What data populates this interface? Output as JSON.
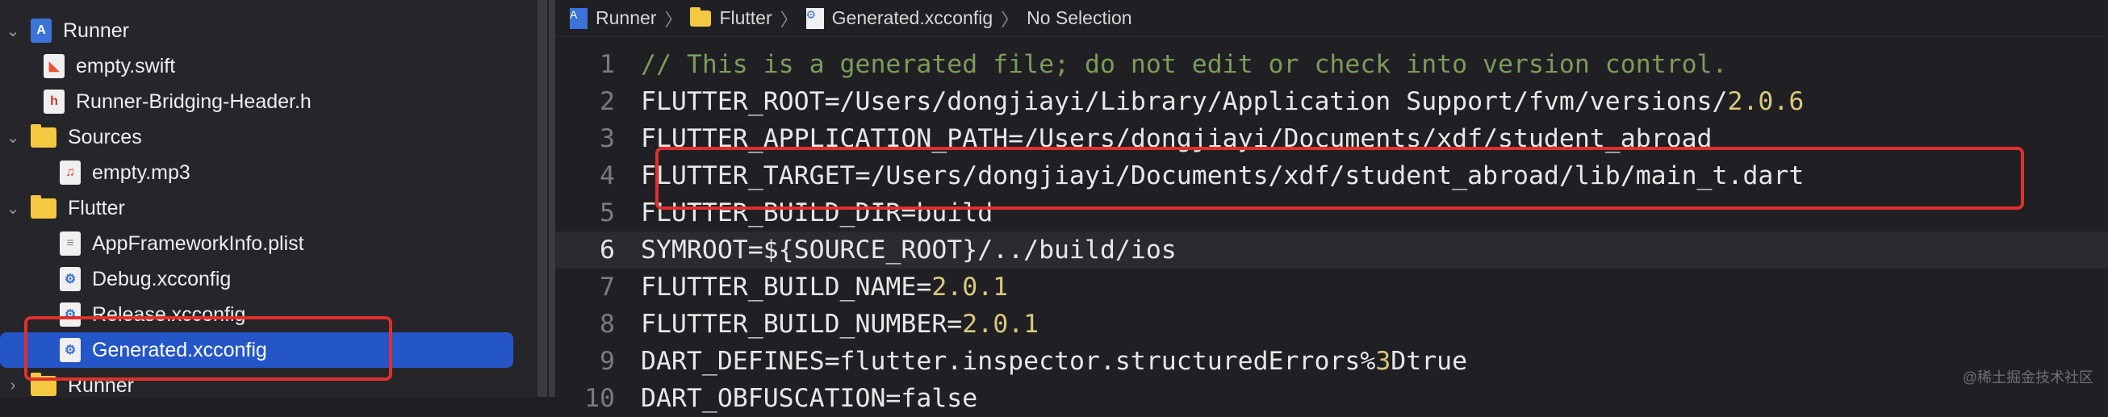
{
  "navigator": {
    "items": [
      {
        "label": "Runner",
        "icon": "project-icon",
        "kind": "project",
        "chevron": "⌄"
      },
      {
        "label": "empty.swift",
        "icon": "swift-file-icon",
        "kind": "swift"
      },
      {
        "label": "Runner-Bridging-Header.h",
        "icon": "header-file-icon",
        "kind": "h"
      },
      {
        "label": "Sources",
        "icon": "folder-icon",
        "kind": "folder",
        "chevron": "⌄"
      },
      {
        "label": "empty.mp3",
        "icon": "audio-file-icon",
        "kind": "mp3"
      },
      {
        "label": "Flutter",
        "icon": "folder-icon",
        "kind": "folder",
        "chevron": "⌄"
      },
      {
        "label": "AppFrameworkInfo.plist",
        "icon": "plist-file-icon",
        "kind": "plist"
      },
      {
        "label": "Debug.xcconfig",
        "icon": "xcconfig-file-icon",
        "kind": "xcconfig"
      },
      {
        "label": "Release.xcconfig",
        "icon": "xcconfig-file-icon",
        "kind": "xcconfig"
      },
      {
        "label": "Generated.xcconfig",
        "icon": "xcconfig-file-icon",
        "kind": "xcconfig",
        "selected": true
      },
      {
        "label": "Runner",
        "icon": "folder-icon",
        "kind": "folder",
        "chevron": "›"
      }
    ]
  },
  "jumpbar": {
    "crumbs": [
      "Runner",
      "Flutter",
      "Generated.xcconfig",
      "No Selection"
    ]
  },
  "editor": {
    "current_line": 6,
    "lines": [
      {
        "num": "1",
        "text": "// This is a generated file; do not edit or check into version control.",
        "type": "comment"
      },
      {
        "num": "2",
        "text": "FLUTTER_ROOT=/Users/dongjiayi/Library/Application Support/fvm/versions/",
        "num_suffix": "2.0.6"
      },
      {
        "num": "3",
        "text": "FLUTTER_APPLICATION_PATH=/Users/dongjiayi/Documents/xdf/student_abroad"
      },
      {
        "num": "4",
        "text": "FLUTTER_TARGET=/Users/dongjiayi/Documents/xdf/student_abroad/lib/main_t.dart"
      },
      {
        "num": "5",
        "text": "FLUTTER_BUILD_DIR=build"
      },
      {
        "num": "6",
        "text": "SYMROOT=${SOURCE_ROOT}/../build/ios"
      },
      {
        "num": "7",
        "text": "FLUTTER_BUILD_NAME=",
        "num_suffix": "2.0.1"
      },
      {
        "num": "8",
        "text": "FLUTTER_BUILD_NUMBER=",
        "num_suffix": "2.0.1"
      },
      {
        "num": "9",
        "text": "DART_DEFINES=flutter.inspector.structuredErrors%",
        "num_suffix": "3",
        "text_after": "Dtrue"
      },
      {
        "num": "10",
        "text": "DART_OBFUSCATION=false"
      }
    ]
  },
  "watermark": "@稀土掘金技术社区",
  "colors": {
    "highlight_box": "#e0302c",
    "selection": "#2456c8",
    "comment": "#7c9c5a",
    "number": "#d9c97c"
  }
}
